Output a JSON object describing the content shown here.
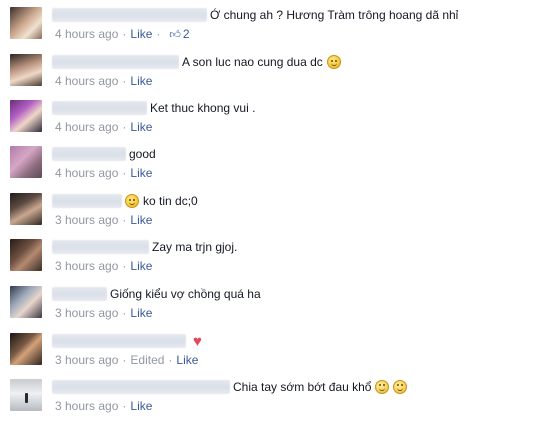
{
  "comments": [
    {
      "text": "Ớ chung ah ? Hương Tràm trông hoang dã nhỉ",
      "time": "4 hours ago",
      "like": "Like",
      "like_count": "2",
      "emoji": ""
    },
    {
      "text": "A son luc nao cung dua dc",
      "time": "4 hours ago",
      "like": "Like",
      "emoji": "smile-emoji"
    },
    {
      "text": "Ket thuc khong vui .",
      "time": "4 hours ago",
      "like": "Like",
      "emoji": ""
    },
    {
      "text": "good",
      "time": "4 hours ago",
      "like": "Like",
      "emoji": ""
    },
    {
      "text": "ko tin dc;0",
      "time": "3 hours ago",
      "like": "Like",
      "emoji": "smile-emoji"
    },
    {
      "text": "Zay ma trjn gjoj.",
      "time": "3 hours ago",
      "like": "Like",
      "emoji": ""
    },
    {
      "text": "Giống kiểu vợ chồng quá ha",
      "time": "3 hours ago",
      "like": "Like",
      "emoji": ""
    },
    {
      "text": "",
      "time": "3 hours ago",
      "edited": "Edited",
      "like": "Like",
      "emoji": "heart-emoji"
    },
    {
      "text": "Chia tay sớm bớt đau khổ",
      "time": "3 hours ago",
      "like": "Like",
      "emoji": "cry-emoji"
    }
  ],
  "colors": {
    "link": "#3b5998",
    "meta": "#9197a3",
    "text": "#141823"
  }
}
